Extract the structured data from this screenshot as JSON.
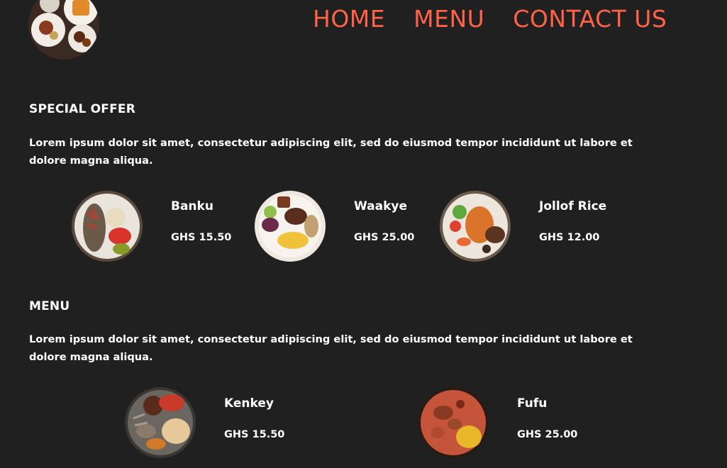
{
  "nav": {
    "items": [
      {
        "label": "HOME"
      },
      {
        "label": "MENU"
      },
      {
        "label": "CONTACT US"
      }
    ]
  },
  "special_offer": {
    "title": "SPECIAL OFFER",
    "description": "Lorem ipsum dolor sit amet, consectetur adipiscing elit, sed do eiusmod tempor incididunt ut labore et dolore magna aliqua.",
    "items": [
      {
        "name": "Banku",
        "price": "GHS 15.50"
      },
      {
        "name": "Waakye",
        "price": "GHS 25.00"
      },
      {
        "name": "Jollof Rice",
        "price": "GHS 12.00"
      }
    ]
  },
  "menu": {
    "title": "MENU",
    "description": "Lorem ipsum dolor sit amet, consectetur adipiscing elit, sed do eiusmod tempor incididunt ut labore et dolore magna aliqua.",
    "items": [
      {
        "name": "Kenkey",
        "price": "GHS 15.50"
      },
      {
        "name": "Fufu",
        "price": "GHS 25.00"
      }
    ]
  },
  "colors": {
    "background": "#202020",
    "accent": "#ff6347",
    "text": "#ffffff"
  }
}
